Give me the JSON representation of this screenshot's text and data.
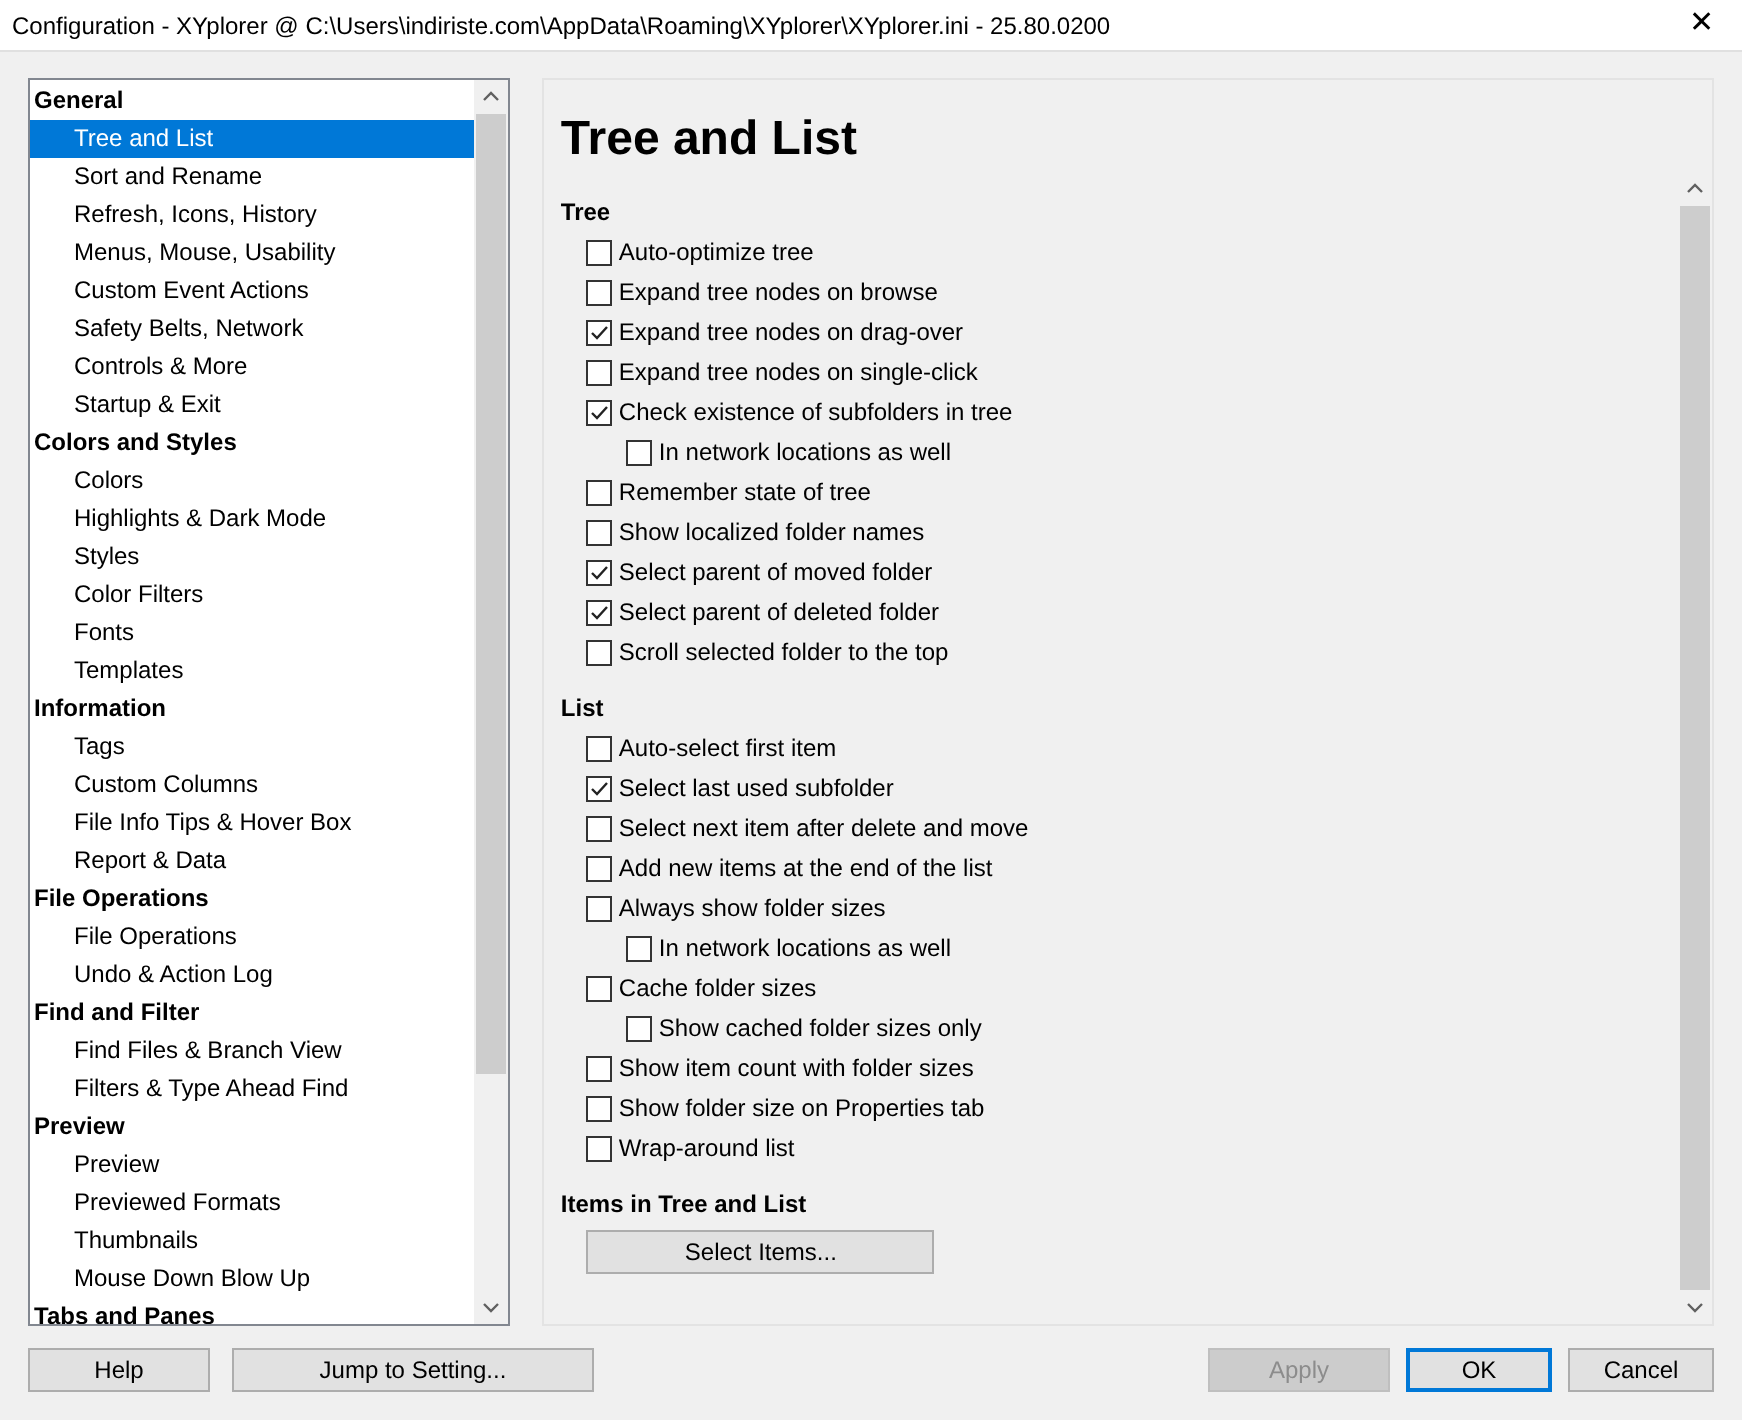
{
  "window": {
    "title": "Configuration - XYplorer @ C:\\Users\\indiriste.com\\AppData\\Roaming\\XYplorer\\XYplorer.ini - 25.80.0200",
    "close": "✕"
  },
  "sidebar": {
    "groups": [
      {
        "label": "General",
        "items": [
          {
            "label": "Tree and List",
            "selected": true
          },
          {
            "label": "Sort and Rename",
            "selected": false
          },
          {
            "label": "Refresh, Icons, History",
            "selected": false
          },
          {
            "label": "Menus, Mouse, Usability",
            "selected": false
          },
          {
            "label": "Custom Event Actions",
            "selected": false
          },
          {
            "label": "Safety Belts, Network",
            "selected": false
          },
          {
            "label": "Controls & More",
            "selected": false
          },
          {
            "label": "Startup & Exit",
            "selected": false
          }
        ]
      },
      {
        "label": "Colors and Styles",
        "items": [
          {
            "label": "Colors",
            "selected": false
          },
          {
            "label": "Highlights & Dark Mode",
            "selected": false
          },
          {
            "label": "Styles",
            "selected": false
          },
          {
            "label": "Color Filters",
            "selected": false
          },
          {
            "label": "Fonts",
            "selected": false
          },
          {
            "label": "Templates",
            "selected": false
          }
        ]
      },
      {
        "label": "Information",
        "items": [
          {
            "label": "Tags",
            "selected": false
          },
          {
            "label": "Custom Columns",
            "selected": false
          },
          {
            "label": "File Info Tips & Hover Box",
            "selected": false
          },
          {
            "label": "Report & Data",
            "selected": false
          }
        ]
      },
      {
        "label": "File Operations",
        "items": [
          {
            "label": "File Operations",
            "selected": false
          },
          {
            "label": "Undo & Action Log",
            "selected": false
          }
        ]
      },
      {
        "label": "Find and Filter",
        "items": [
          {
            "label": "Find Files & Branch View",
            "selected": false
          },
          {
            "label": "Filters & Type Ahead Find",
            "selected": false
          }
        ]
      },
      {
        "label": "Preview",
        "items": [
          {
            "label": "Preview",
            "selected": false
          },
          {
            "label": "Previewed Formats",
            "selected": false
          },
          {
            "label": "Thumbnails",
            "selected": false
          },
          {
            "label": "Mouse Down Blow Up",
            "selected": false
          }
        ]
      },
      {
        "label": "Tabs and Panes"
      }
    ]
  },
  "page": {
    "title": "Tree and List",
    "sections": [
      {
        "heading": "Tree",
        "options": [
          {
            "label": "Auto-optimize tree",
            "checked": false
          },
          {
            "label": "Expand tree nodes on browse",
            "checked": false
          },
          {
            "label": "Expand tree nodes on drag-over",
            "checked": true
          },
          {
            "label": "Expand tree nodes on single-click",
            "checked": false
          },
          {
            "label": "Check existence of subfolders in tree",
            "checked": true,
            "children": [
              {
                "label": "In network locations as well",
                "checked": false
              }
            ]
          },
          {
            "label": "Remember state of tree",
            "checked": false
          },
          {
            "label": "Show localized folder names",
            "checked": false
          },
          {
            "label": "Select parent of moved folder",
            "checked": true
          },
          {
            "label": "Select parent of deleted folder",
            "checked": true
          },
          {
            "label": "Scroll selected folder to the top",
            "checked": false
          }
        ]
      },
      {
        "heading": "List",
        "options": [
          {
            "label": "Auto-select first item",
            "checked": false
          },
          {
            "label": "Select last used subfolder",
            "checked": true
          },
          {
            "label": "Select next item after delete and move",
            "checked": false
          },
          {
            "label": "Add new items at the end of the list",
            "checked": false
          },
          {
            "label": "Always show folder sizes",
            "checked": false,
            "children": [
              {
                "label": "In network locations as well",
                "checked": false
              }
            ]
          },
          {
            "label": "Cache folder sizes",
            "checked": false,
            "children": [
              {
                "label": "Show cached folder sizes only",
                "checked": false
              }
            ]
          },
          {
            "label": "Show item count with folder sizes",
            "checked": false
          },
          {
            "label": "Show folder size on Properties tab",
            "checked": false
          },
          {
            "label": "Wrap-around list",
            "checked": false
          }
        ]
      },
      {
        "heading": "Items in Tree and List",
        "button": "Select Items..."
      }
    ]
  },
  "footer": {
    "left": [
      {
        "label": "Help"
      },
      {
        "label": "Jump to Setting..."
      }
    ],
    "right": [
      {
        "label": "Apply",
        "disabled": true,
        "focused": false
      },
      {
        "label": "OK",
        "disabled": false,
        "focused": true
      },
      {
        "label": "Cancel",
        "disabled": false,
        "focused": false
      }
    ]
  }
}
